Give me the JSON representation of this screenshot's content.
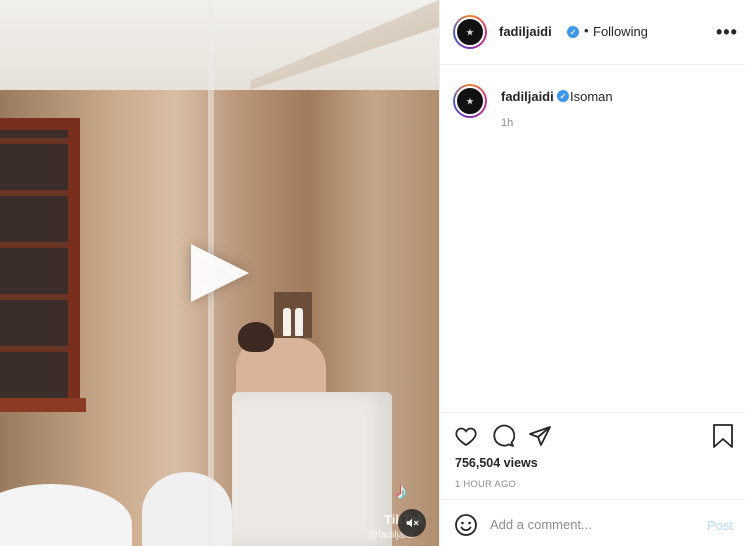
{
  "post": {
    "username": "fadiljaidi",
    "follow_status": "Following",
    "caption": "Isoman",
    "caption_time": "1h",
    "views": "756,504 views",
    "posted_ago": "1 HOUR AGO"
  },
  "media": {
    "watermark_brand": "TikTok",
    "watermark_user": "@fadiljaidi",
    "play_icon": "play-icon",
    "mute_icon": "muted-speaker-icon"
  },
  "comment": {
    "placeholder": "Add a comment...",
    "post_label": "Post"
  },
  "colors": {
    "verified_blue": "#3897f0",
    "post_disabled": "#b2dffc",
    "muted_text": "#8e8e8e"
  }
}
